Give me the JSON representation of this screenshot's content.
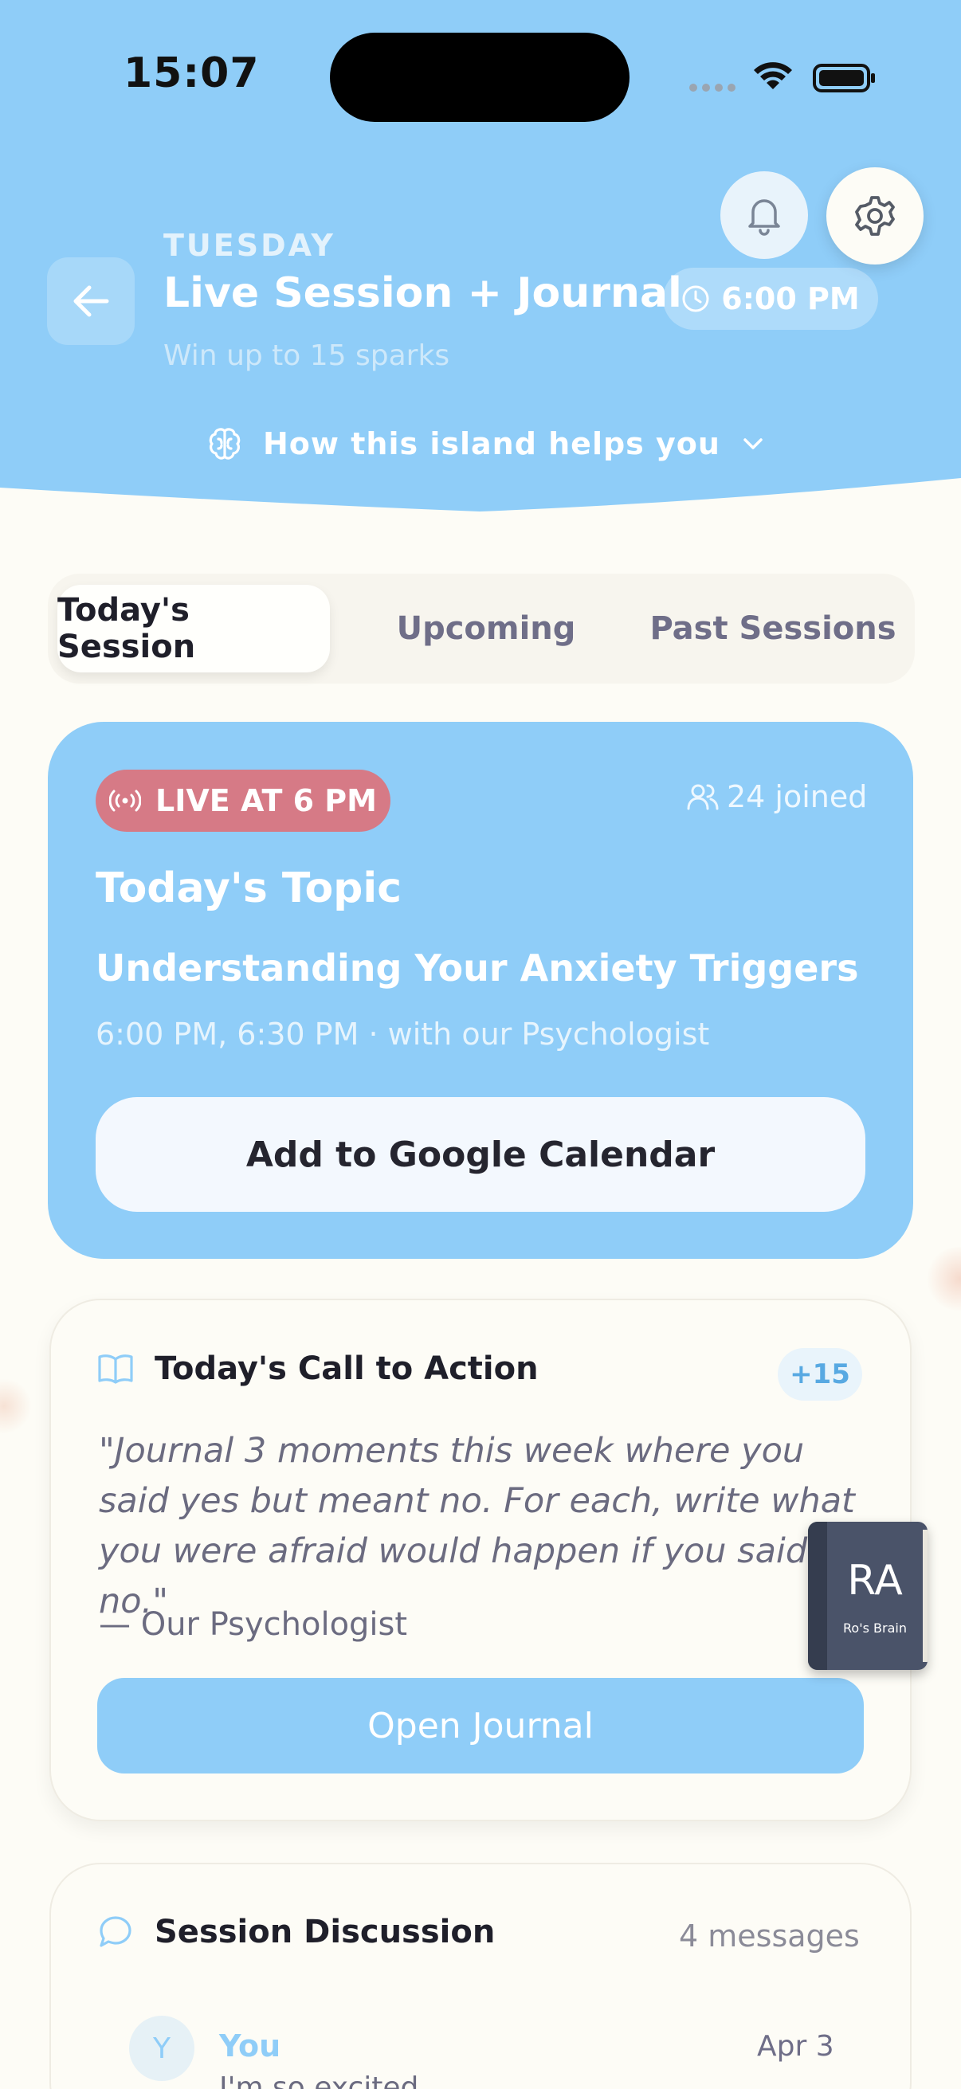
{
  "colors": {
    "header_bg": "#8fcdf8",
    "page_bg": "#fdfcf6",
    "live_badge": "#d67a86",
    "accent": "#8fcdf8"
  },
  "status_bar": {
    "time": "15:07",
    "icons": [
      "signal-icon",
      "wifi-icon",
      "battery-icon"
    ]
  },
  "header": {
    "day": "TUESDAY",
    "title": "Live Session + Journal",
    "time": "6:00 PM",
    "subtitle": "Win up to 15 sparks",
    "helps_label": "How this island helps you",
    "icons": [
      "bell-icon",
      "gear-icon",
      "back-arrow-icon",
      "clock-icon",
      "brain-icon",
      "chevron-down-icon"
    ]
  },
  "tabs": [
    {
      "label": "Today's Session",
      "active": true
    },
    {
      "label": "Upcoming",
      "active": false
    },
    {
      "label": "Past Sessions",
      "active": false
    }
  ],
  "live_session": {
    "badge": "LIVE AT 6 PM",
    "joined": "24 joined",
    "topic_label": "Today's Topic",
    "topic_title": "Understanding Your Anxiety Triggers",
    "meta": "6:00 PM, 6:30 PM · with our Psychologist",
    "calendar_button": "Add to Google Calendar"
  },
  "call_to_action": {
    "title": "Today's Call to Action",
    "points": "+15",
    "quote": "\"Journal 3 moments this week where you said yes but meant no. For each, write what you were afraid would happen if you said no.\"",
    "attribution": "— Our Psychologist",
    "button": "Open Journal"
  },
  "floating_book": {
    "initials": "RA",
    "subtitle": "Ro's Brain"
  },
  "discussion": {
    "title": "Session Discussion",
    "count": "4 messages",
    "messages": [
      {
        "avatar": "Y",
        "author": "You",
        "date": "Apr 3",
        "text": "I'm so excited..."
      }
    ]
  }
}
